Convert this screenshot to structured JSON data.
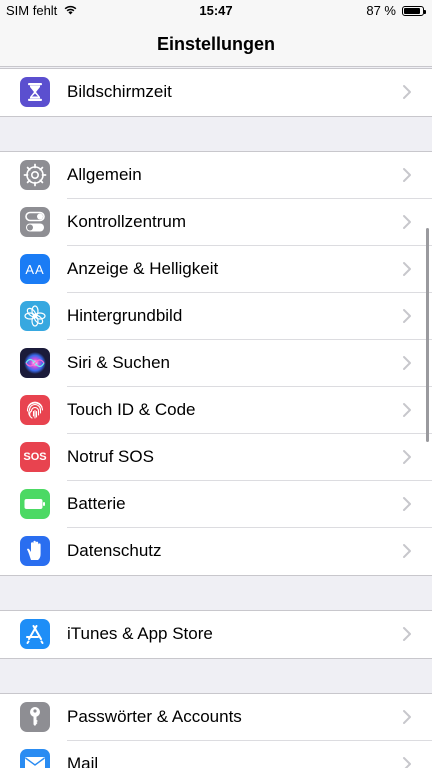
{
  "status_bar": {
    "carrier": "SIM fehlt",
    "time": "15:47",
    "battery_percent": "87 %",
    "battery_level": 0.87
  },
  "nav": {
    "title": "Einstellungen"
  },
  "group1": {
    "items": [
      {
        "label": "Bildschirmzeit",
        "icon": "hourglass-icon",
        "color": "#5b4fcf"
      }
    ]
  },
  "group2": {
    "items": [
      {
        "label": "Allgemein",
        "icon": "gear-icon",
        "color": "#8e8e93"
      },
      {
        "label": "Kontrollzentrum",
        "icon": "toggles-icon",
        "color": "#8e8e93"
      },
      {
        "label": "Anzeige & Helligkeit",
        "icon": "text-size-icon",
        "icon_text": "AA",
        "color": "#1a7cf5"
      },
      {
        "label": "Hintergrundbild",
        "icon": "flower-icon",
        "color": "#37a8e0"
      },
      {
        "label": "Siri & Suchen",
        "icon": "siri-icon",
        "color": "#1b1b3a"
      },
      {
        "label": "Touch ID & Code",
        "icon": "fingerprint-icon",
        "color": "#e8434f"
      },
      {
        "label": "Notruf SOS",
        "icon": "sos-icon",
        "icon_text": "SOS",
        "color": "#e8434f"
      },
      {
        "label": "Batterie",
        "icon": "battery-icon",
        "color": "#4cd964"
      },
      {
        "label": "Datenschutz",
        "icon": "hand-icon",
        "color": "#2a6ef0"
      }
    ]
  },
  "group3": {
    "items": [
      {
        "label": "iTunes & App Store",
        "icon": "app-store-icon",
        "color": "#1e8ef7"
      }
    ]
  },
  "group4": {
    "items": [
      {
        "label": "Passwörter & Accounts",
        "icon": "key-icon",
        "color": "#8e8e93"
      },
      {
        "label": "Mail",
        "icon": "mail-icon",
        "color": "#2a8cf2"
      }
    ]
  }
}
